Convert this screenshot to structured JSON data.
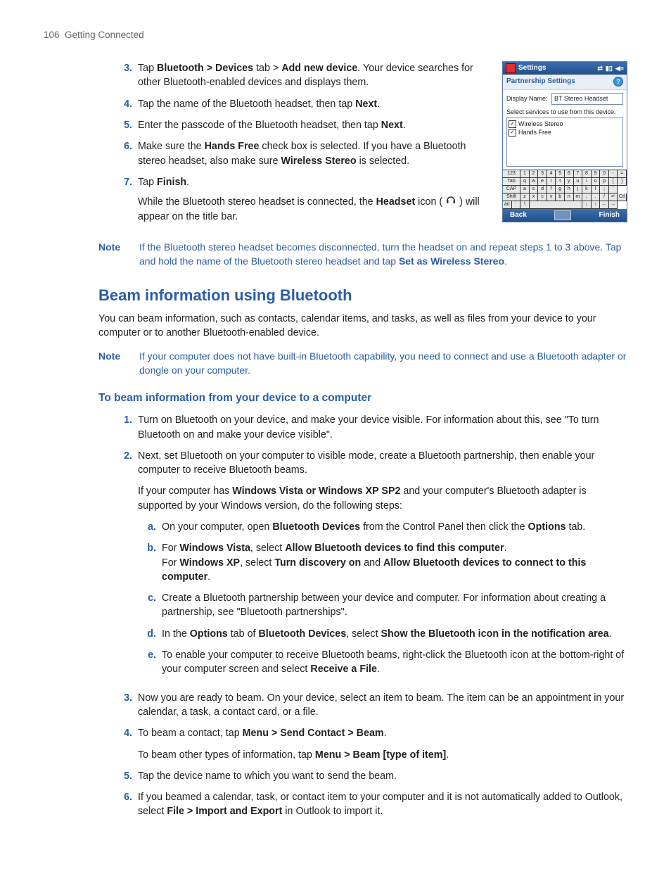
{
  "header": {
    "page_number": "106",
    "section": "Getting Connected"
  },
  "steps_top": {
    "s3_a": "Tap ",
    "s3_b1": "Bluetooth > Devices",
    "s3_c": " tab > ",
    "s3_b2": "Add new device",
    "s3_d": ". Your device searches for other Bluetooth-enabled devices and displays them.",
    "s4_a": "Tap the name of the Bluetooth headset, then tap ",
    "s4_b": "Next",
    "s4_c": ".",
    "s5_a": "Enter the passcode of the Bluetooth headset, then tap ",
    "s5_b": "Next",
    "s5_c": ".",
    "s6_a": "Make sure the ",
    "s6_b": "Hands Free",
    "s6_c": " check box is selected. If you have a Bluetooth stereo headset, also make sure ",
    "s6_d": "Wireless Stereo",
    "s6_e": " is selected.",
    "s7_a": "Tap ",
    "s7_b": "Finish",
    "s7_c": ".",
    "s7_sub_a": "While the Bluetooth stereo headset is connected, the ",
    "s7_sub_b": "Headset",
    "s7_sub_c": " icon ( ",
    "s7_sub_d": " ) will appear on the title bar."
  },
  "shot": {
    "title": "Settings",
    "subtitle": "Partnership Settings",
    "display_name_label": "Display Name:",
    "display_name_value": "BT Stereo Headset",
    "hint": "Select services to use from this device.",
    "svc1": "Wireless Stereo",
    "svc2": "Hands Free",
    "back": "Back",
    "finish": "Finish",
    "kbd": {
      "r1": [
        "123",
        "1",
        "2",
        "3",
        "4",
        "5",
        "6",
        "7",
        "8",
        "9",
        "0",
        "-",
        "=",
        "◄"
      ],
      "r2": [
        "Tab",
        "q",
        "w",
        "e",
        "r",
        "t",
        "y",
        "u",
        "i",
        "o",
        "p",
        "[",
        "]"
      ],
      "r3": [
        "CAP",
        "a",
        "s",
        "d",
        "f",
        "g",
        "h",
        "j",
        "k",
        "l",
        ";",
        "'"
      ],
      "r4": [
        "Shift",
        "z",
        "x",
        "c",
        "v",
        "b",
        "n",
        "m",
        ",",
        ".",
        "/",
        "↵"
      ],
      "r5": [
        "Ctl",
        "áü",
        "`",
        "\\",
        "space",
        "↓",
        "↑",
        "←",
        "→"
      ]
    }
  },
  "note1": {
    "label": "Note",
    "a": "If the Bluetooth stereo headset becomes disconnected, turn the headset on and repeat steps 1 to 3 above. Tap and hold the name of the Bluetooth stereo headset and tap ",
    "b": "Set as Wireless Stereo",
    "c": "."
  },
  "beam_section": {
    "title": "Beam information using Bluetooth",
    "intro": "You can beam information, such as contacts, calendar items, and tasks, as well as files from your device to your computer or to another Bluetooth-enabled device."
  },
  "note2": {
    "label": "Note",
    "body": "If your computer does not have built-in Bluetooth capability, you need to connect and use a Bluetooth adapter or dongle on your computer."
  },
  "beam_sub_title": "To beam information from your device to a computer",
  "beam_steps": {
    "s1": "Turn on Bluetooth on your device, and make your device visible. For information about this, see \"To turn Bluetooth on and make your device visible\".",
    "s2": "Next, set Bluetooth on your computer to visible mode, create a Bluetooth partnership, then enable your computer to receive Bluetooth beams.",
    "s2_sub_a": "If your computer has ",
    "s2_sub_b": "Windows Vista or Windows XP SP2",
    "s2_sub_c": " and your computer's Bluetooth adapter is supported by your Windows version, do the following steps:",
    "a_a": "On your computer, open ",
    "a_b": "Bluetooth Devices",
    "a_c": " from the Control Panel then click the ",
    "a_d": "Options",
    "a_e": " tab.",
    "b_a": "For ",
    "b_b": "Windows Vista",
    "b_c": ", select ",
    "b_d": "Allow Bluetooth devices to find this computer",
    "b_e": ".",
    "b2_a": "For ",
    "b2_b": "Windows XP",
    "b2_c": ", select ",
    "b2_d": "Turn discovery on",
    "b2_e": " and ",
    "b2_f": "Allow Bluetooth devices to connect to this computer",
    "b2_g": ".",
    "c": "Create a Bluetooth partnership between your device and computer. For information about creating a partnership, see \"Bluetooth partnerships\".",
    "d_a": "In the ",
    "d_b": "Options",
    "d_c": " tab of ",
    "d_d": "Bluetooth Devices",
    "d_e": ", select ",
    "d_f": "Show the Bluetooth icon in the notification area",
    "d_g": ".",
    "e_a": "To enable your computer to receive Bluetooth beams, right-click the Bluetooth icon at the bottom-right of your computer screen and select ",
    "e_b": "Receive a File",
    "e_c": ".",
    "s3": "Now you are ready to beam. On your device, select an item to beam. The item can be an appointment in your calendar, a task, a contact card, or a file.",
    "s4_a": "To beam a contact, tap ",
    "s4_b": "Menu > Send Contact > Beam",
    "s4_c": ".",
    "s4_sub_a": "To beam other types of information, tap ",
    "s4_sub_b": "Menu > Beam [type of item]",
    "s4_sub_c": ".",
    "s5": "Tap the device name to which you want to send the beam.",
    "s6_a": "If you beamed a calendar, task, or contact item to your computer and it is not automatically added to Outlook, select ",
    "s6_b": "File > Import and Export",
    "s6_c": " in Outlook to import it."
  },
  "nums": {
    "n3": "3.",
    "n4": "4.",
    "n5": "5.",
    "n6": "6.",
    "n7": "7.",
    "b1": "1.",
    "b2": "2.",
    "b3": "3.",
    "b4": "4.",
    "b5": "5.",
    "b6": "6.",
    "la": "a.",
    "lb": "b.",
    "lc": "c.",
    "ld": "d.",
    "le": "e."
  }
}
